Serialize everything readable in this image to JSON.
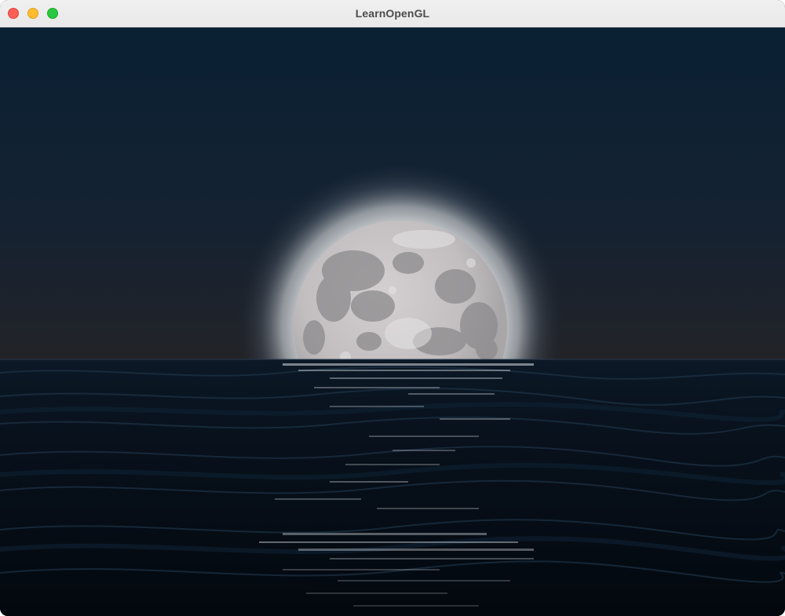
{
  "window": {
    "title": "LearnOpenGL",
    "controls": {
      "close_icon": "close-icon",
      "minimize_icon": "minimize-icon",
      "maximize_icon": "maximize-icon"
    }
  },
  "scene": {
    "description_icon": "rendered-3d-scene",
    "colors": {
      "sky_top": "#0a2033",
      "sky_horizon": "#1f2229",
      "moon": "#bfbbbd",
      "moon_glow": "#c9cbcc",
      "ocean_top": "#0b1420",
      "ocean_bottom": "#02070d",
      "highlight": "#d8dde3"
    }
  }
}
